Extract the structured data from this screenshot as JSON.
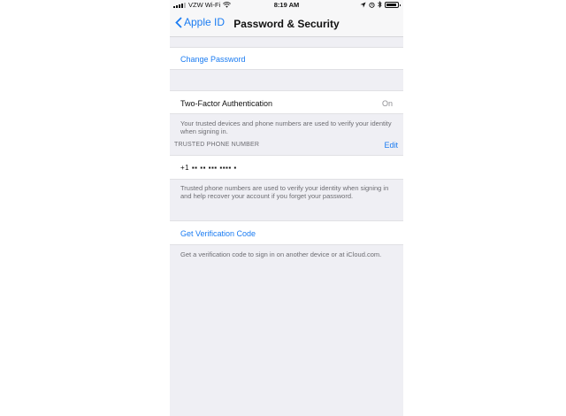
{
  "status_bar": {
    "carrier": "VZW Wi-Fi",
    "time": "8:19 AM",
    "icons": [
      "signal-icon",
      "wifi-icon",
      "location-icon",
      "alarm-icon",
      "bluetooth-icon",
      "battery-icon"
    ]
  },
  "nav": {
    "back_label": "Apple ID",
    "title": "Password & Security"
  },
  "change_password": {
    "label": "Change Password"
  },
  "two_factor": {
    "label": "Two-Factor Authentication",
    "value": "On",
    "footnote": "Your trusted devices and phone numbers are used to verify your identity when signing in."
  },
  "trusted_phone": {
    "header": "TRUSTED PHONE NUMBER",
    "edit_label": "Edit",
    "number": "+1 ▪▪ ▪▪ ▪▪▪ ▪▪▪▪ ▪",
    "footnote": "Trusted phone numbers are used to verify your identity when signing in and help recover your account if you forget your password."
  },
  "verification": {
    "label": "Get Verification Code",
    "footnote": "Get a verification code to sign in on another device or at iCloud.com."
  },
  "colors": {
    "accent": "#1b7cf2",
    "background": "#efeff4",
    "secondary_text": "#6d6d72"
  }
}
